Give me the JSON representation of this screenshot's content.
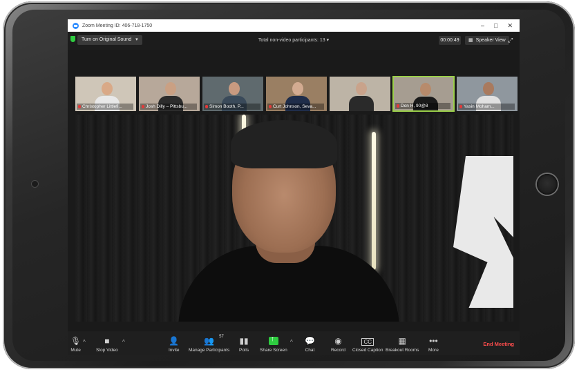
{
  "window": {
    "title": "Zoom Meeting ID: 406-718-1750",
    "controls": [
      "–",
      "□",
      "✕"
    ]
  },
  "topbar": {
    "original_sound": "Turn on Original Sound",
    "participants_info": "Total non-video participants: 13",
    "timer": "00:00:49",
    "view_mode": "Speaker View"
  },
  "thumbnails": [
    {
      "name": "Christopher Littlefi...",
      "bg": "#cfc6b8",
      "skin": "#d9a987",
      "shirt": "#e8e8e8",
      "active": false
    },
    {
      "name": "Josh Dilly – Pittsbu...",
      "bg": "#b7a89a",
      "skin": "#caa083",
      "shirt": "#2c2c2c",
      "active": false
    },
    {
      "name": "Simon Booth, P...",
      "bg": "#5f6a6e",
      "skin": "#c89a80",
      "shirt": "#3a4a5a",
      "active": false
    },
    {
      "name": "Curt Johnson, Seva...",
      "bg": "#9a7f63",
      "skin": "#d3ab91",
      "shirt": "#1f2d4a",
      "active": false
    },
    {
      "name": "",
      "bg": "#bdb4a6",
      "skin": "#c9a38b",
      "shirt": "#2a2a2a",
      "active": false
    },
    {
      "name": "Don H, 90@8",
      "bg": "#a69d91",
      "skin": "#b78b6c",
      "shirt": "#1a1a1a",
      "active": true
    },
    {
      "name": "Yasin Moham...",
      "bg": "#8f979e",
      "skin": "#a97a5e",
      "shirt": "#e0e0e0",
      "active": false
    }
  ],
  "toolbar": {
    "mute": "Mute",
    "stop_video": "Stop Video",
    "invite": "Invite",
    "manage_participants": "Manage Participants",
    "participants_count": "57",
    "polls": "Polls",
    "share_screen": "Share Screen",
    "chat": "Chat",
    "record": "Record",
    "closed_caption": "Closed Caption",
    "breakout_rooms": "Breakout Rooms",
    "more": "More",
    "end_meeting": "End Meeting"
  },
  "icons": {
    "mute": "microphone-icon",
    "video": "video-camera-icon",
    "invite": "add-person-icon",
    "participants": "people-icon",
    "polls": "bar-chart-icon",
    "share": "share-screen-icon",
    "chat": "chat-bubble-icon",
    "record": "record-icon",
    "caption": "cc-icon",
    "breakout": "grid-icon",
    "more": "more-dots-icon"
  },
  "colors": {
    "accent_green": "#2ecc40",
    "end_meeting_red": "#ff4d4d",
    "active_border": "#9bd04a"
  }
}
